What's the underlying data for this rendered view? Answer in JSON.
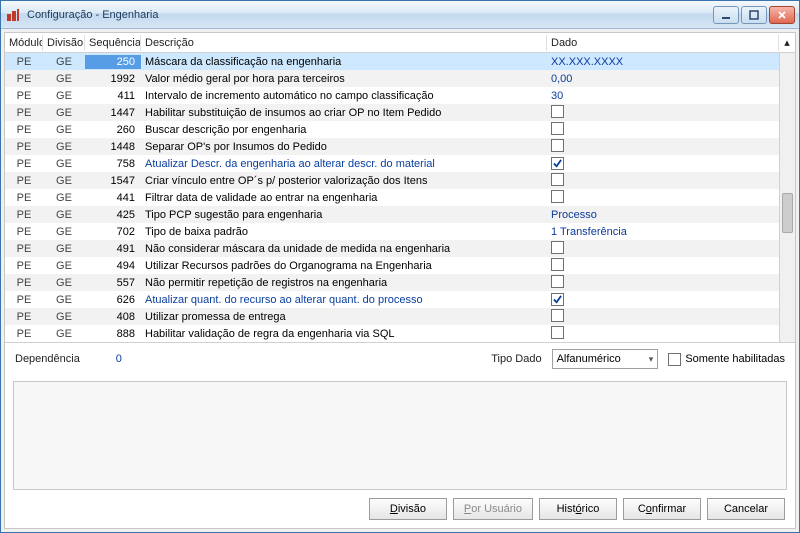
{
  "window": {
    "title": "Configuração - Engenharia"
  },
  "grid": {
    "headers": {
      "modulo": "Módulo",
      "divisao": "Divisão",
      "sequencia": "Sequência",
      "descricao": "Descrição",
      "dado": "Dado"
    },
    "rows": [
      {
        "mod": "PE",
        "div": "GE",
        "seq": "250",
        "desc": "Máscara da classificação na engenharia",
        "dado_type": "text",
        "dado": "XX.XXX.XXXX",
        "selected": true
      },
      {
        "mod": "PE",
        "div": "GE",
        "seq": "1992",
        "desc": "Valor médio geral por hora para terceiros",
        "dado_type": "text",
        "dado": "0,00"
      },
      {
        "mod": "PE",
        "div": "GE",
        "seq": "411",
        "desc": "Intervalo de incremento automático no campo classificação",
        "dado_type": "text",
        "dado": "30"
      },
      {
        "mod": "PE",
        "div": "GE",
        "seq": "1447",
        "desc": "Habilitar substituição de insumos ao criar OP no Item Pedido",
        "dado_type": "check",
        "checked": false
      },
      {
        "mod": "PE",
        "div": "GE",
        "seq": "260",
        "desc": "Buscar descrição por engenharia",
        "dado_type": "check",
        "checked": false
      },
      {
        "mod": "PE",
        "div": "GE",
        "seq": "1448",
        "desc": "Separar OP's por Insumos do Pedido",
        "dado_type": "check",
        "checked": false
      },
      {
        "mod": "PE",
        "div": "GE",
        "seq": "758",
        "desc": "Atualizar Descr. da engenharia ao alterar descr. do material",
        "dado_type": "check",
        "checked": true,
        "link": true
      },
      {
        "mod": "PE",
        "div": "GE",
        "seq": "1547",
        "desc": "Criar vínculo entre OP´s p/ posterior valorização dos Itens",
        "dado_type": "check",
        "checked": false
      },
      {
        "mod": "PE",
        "div": "GE",
        "seq": "441",
        "desc": "Filtrar data de validade ao entrar na engenharia",
        "dado_type": "check",
        "checked": false
      },
      {
        "mod": "PE",
        "div": "GE",
        "seq": "425",
        "desc": "Tipo PCP sugestão para engenharia",
        "dado_type": "text",
        "dado": "Processo"
      },
      {
        "mod": "PE",
        "div": "GE",
        "seq": "702",
        "desc": "Tipo de baixa padrão",
        "dado_type": "text",
        "dado": "1 Transferência"
      },
      {
        "mod": "PE",
        "div": "GE",
        "seq": "491",
        "desc": "Não considerar máscara da unidade de medida na engenharia",
        "dado_type": "check",
        "checked": false
      },
      {
        "mod": "PE",
        "div": "GE",
        "seq": "494",
        "desc": "Utilizar Recursos padrões do Organograma na Engenharia",
        "dado_type": "check",
        "checked": false
      },
      {
        "mod": "PE",
        "div": "GE",
        "seq": "557",
        "desc": "Não permitir repetição de registros na engenharia",
        "dado_type": "check",
        "checked": false
      },
      {
        "mod": "PE",
        "div": "GE",
        "seq": "626",
        "desc": "Atualizar quant. do recurso ao alterar quant. do processo",
        "dado_type": "check",
        "checked": true,
        "link": true
      },
      {
        "mod": "PE",
        "div": "GE",
        "seq": "408",
        "desc": "Utilizar promessa de entrega",
        "dado_type": "check",
        "checked": false
      },
      {
        "mod": "PE",
        "div": "GE",
        "seq": "888",
        "desc": "Habilitar validação de regra da engenharia via SQL",
        "dado_type": "check",
        "checked": false
      }
    ]
  },
  "below": {
    "dependencia_label": "Dependência",
    "dependencia_value": "0",
    "tipo_dado_label": "Tipo Dado",
    "tipo_dado_value": "Alfanumérico",
    "somente_habilitadas": "Somente habilitadas",
    "somente_checked": false
  },
  "footer": {
    "divisao": "Divisão",
    "por_usuario": "Por Usuário",
    "historico": "Histórico",
    "confirmar": "Confirmar",
    "cancelar": "Cancelar"
  }
}
